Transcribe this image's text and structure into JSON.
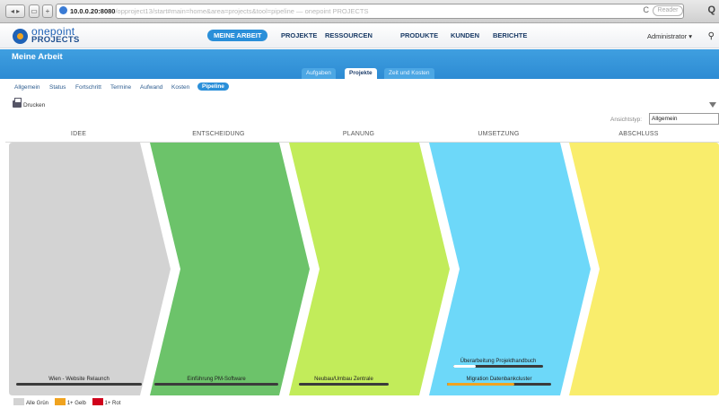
{
  "browser": {
    "url_host": "10.0.0.20:8080",
    "url_rest": "/opproject13/start#main=home&area=projects&tool=pipeline — onepoint PROJECTS",
    "reader_label": "Reader"
  },
  "app": {
    "logo_line1": "onepoint",
    "logo_line2": "PROJECTS",
    "main_nav": [
      "MEINE ARBEIT",
      "PROJEKTE",
      "RESSOURCEN",
      "PRODUKTE",
      "KUNDEN",
      "BERICHTE"
    ],
    "user_menu": "Administrator ▾"
  },
  "section": {
    "title": "Meine Arbeit",
    "subtabs": [
      "Aufgaben",
      "Projekte",
      "Zeit und Kosten"
    ],
    "active_subtab": "Projekte"
  },
  "filters": {
    "tabs": [
      "Allgemein",
      "Status",
      "Fortschritt",
      "Termine",
      "Aufwand",
      "Kosten",
      "Pipeline"
    ],
    "active": "Pipeline"
  },
  "toolbar": {
    "print_label": "Drucken",
    "view_label": "Ansichtstyp:",
    "view_value": "Allgemein"
  },
  "phases": [
    {
      "label": "IDEE",
      "color": "#d3d3d3"
    },
    {
      "label": "ENTSCHEIDUNG",
      "color": "#6cc36a"
    },
    {
      "label": "PLANUNG",
      "color": "#c2ec5a"
    },
    {
      "label": "UMSETZUNG",
      "color": "#6dd8f9"
    },
    {
      "label": "ABSCHLUSS",
      "color": "#f9ed6c"
    }
  ],
  "projects": [
    {
      "name": "Wien - Website Relaunch",
      "phase": 0,
      "progress": 0,
      "status_color": "#3b3b3b"
    },
    {
      "name": "Einführung PM-Software",
      "phase": 1,
      "progress": 0,
      "status_color": "#3b3b3b"
    },
    {
      "name": "Neubau/Umbau Zentrale",
      "phase": 2,
      "progress": 0,
      "status_color": "#3b3b3b"
    },
    {
      "name": "Überarbeitung Projekthandbuch",
      "phase": 3,
      "progress": 0.25,
      "status_color": "#ffffff"
    },
    {
      "name": "Migration Datenbankcluster",
      "phase": 3,
      "progress": 0.65,
      "status_color": "#f0a31f"
    }
  ],
  "legend": [
    {
      "label": "Alle Grün",
      "color": "#d3d3d3"
    },
    {
      "label": "1+ Gelb",
      "color": "#f0a31f"
    },
    {
      "label": "1+ Rot",
      "color": "#d0021b"
    }
  ]
}
